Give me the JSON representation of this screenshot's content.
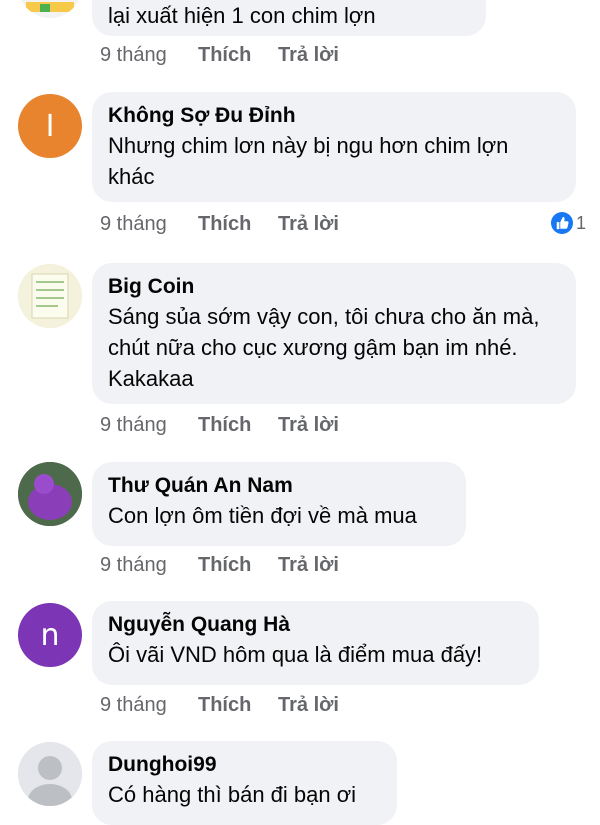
{
  "comments": [
    {
      "author": "",
      "text": "lại xuất hiện 1 con chim lợn",
      "time": "9 tháng",
      "like_label": "Thích",
      "reply_label": "Trả lời",
      "avatar_letter": "",
      "avatar_color": "#e9e9e9"
    },
    {
      "author": "Không Sợ Đu Đỉnh",
      "text": "Nhưng chim lơn này bị ngu hơn chim lợn khác",
      "time": "9 tháng",
      "like_label": "Thích",
      "reply_label": "Trả lời",
      "avatar_letter": "I",
      "avatar_color": "#e8832e",
      "reaction_count": "1"
    },
    {
      "author": "Big Coin",
      "text": "Sáng sủa sớm vậy con, tôi chưa cho ăn mà, chút nữa cho cục xương gậm bạn im nhé. Kakakaa",
      "time": "9 tháng",
      "like_label": "Thích",
      "reply_label": "Trả lời",
      "avatar_letter": "",
      "avatar_color": "#f3f1d8"
    },
    {
      "author": "Thư Quán An Nam",
      "text": "Con lợn ôm tiền đợi về mà mua",
      "time": "9 tháng",
      "like_label": "Thích",
      "reply_label": "Trả lời",
      "avatar_letter": "",
      "avatar_color": "#6b3f8e"
    },
    {
      "author": "Nguyễn Quang Hà",
      "text": "Ôi vãi VND hôm qua là điểm mua đấy!",
      "time": "9 tháng",
      "like_label": "Thích",
      "reply_label": "Trả lời",
      "avatar_letter": "n",
      "avatar_color": "#7b35b5"
    },
    {
      "author": "Dunghoi99",
      "text": "Có hàng thì bán đi bạn ơi",
      "avatar_letter": "",
      "avatar_color": "#dcdcdc"
    }
  ]
}
